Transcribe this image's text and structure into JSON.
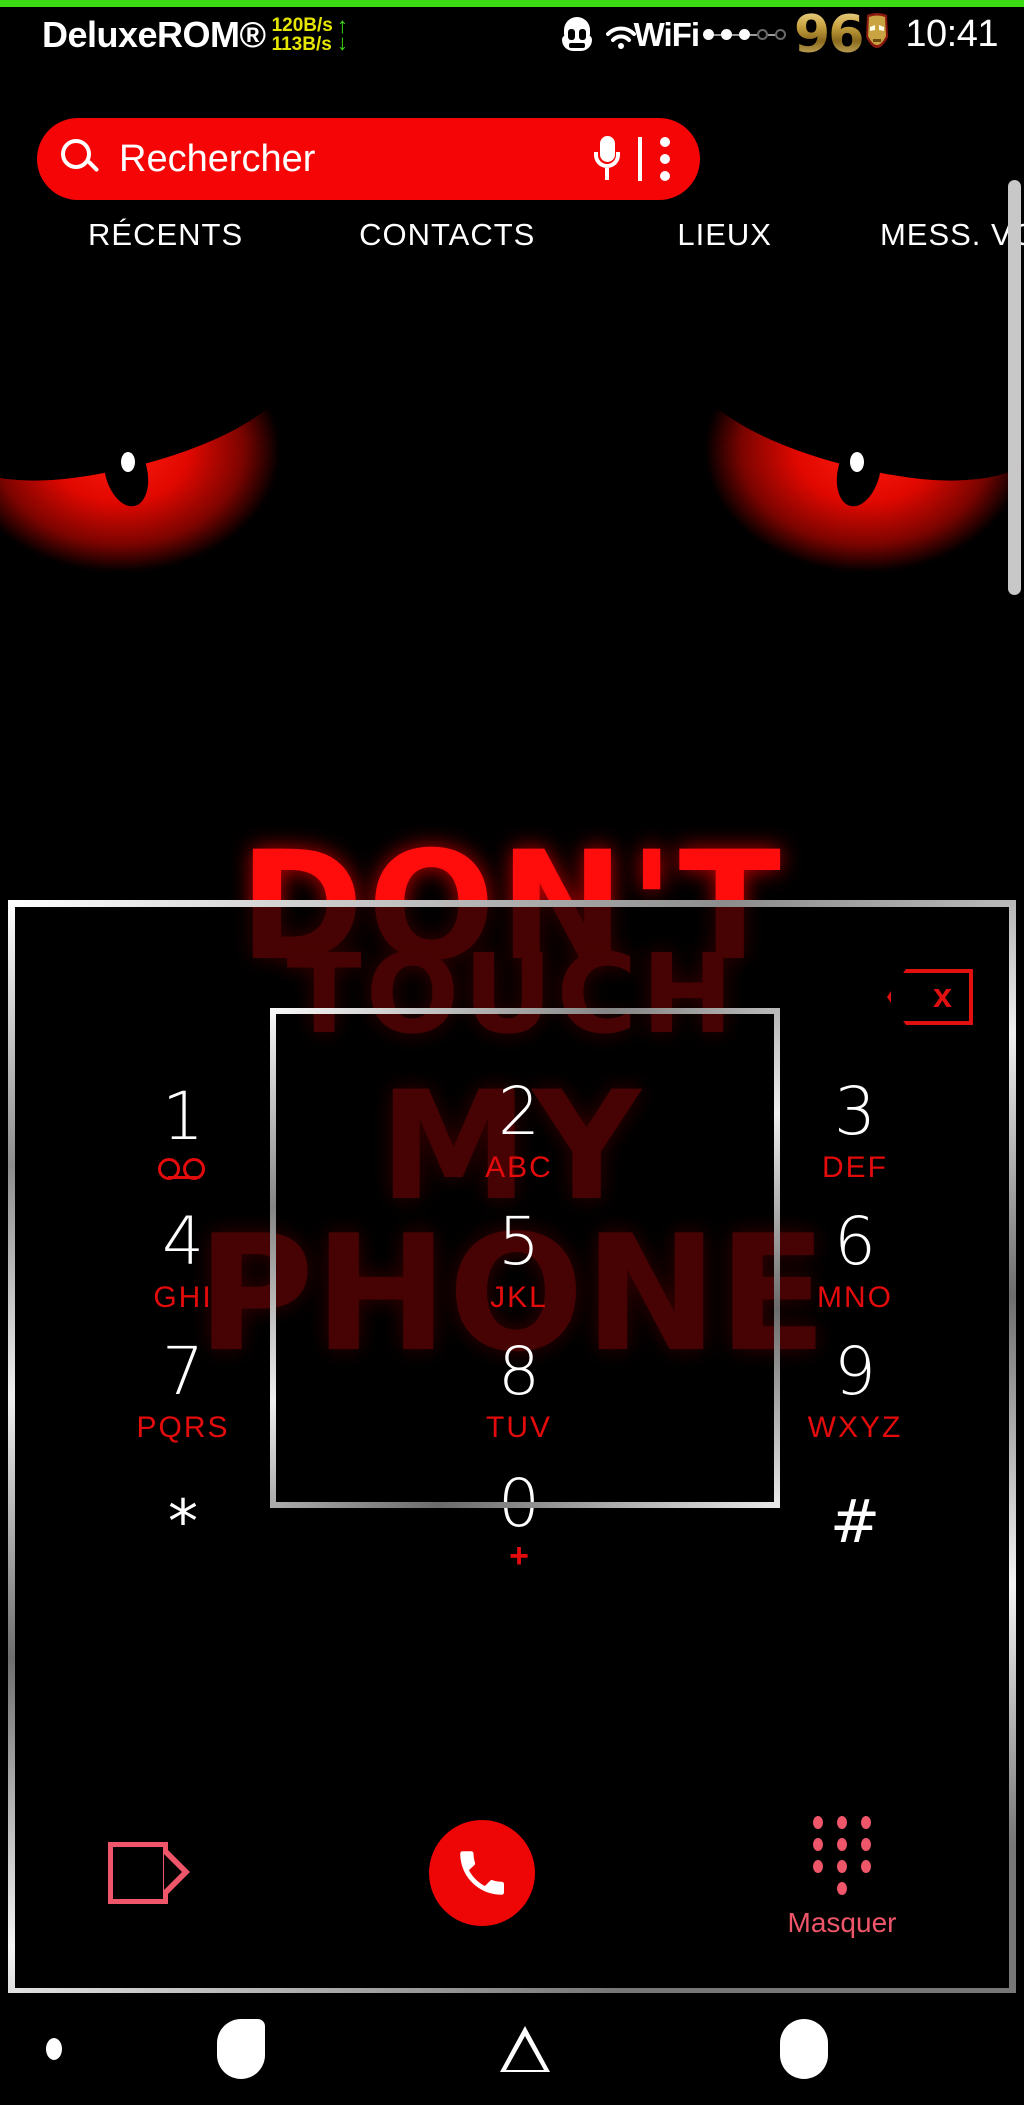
{
  "statusbar": {
    "rom_name": "DeluxeROM®",
    "net_up": "120B/s",
    "net_down": "113B/s",
    "wifi_label": "WiFi",
    "battery": "96",
    "clock": "10:41",
    "icons": {
      "stormtrooper": "stormtrooper-icon",
      "wifi": "wifi-icon",
      "signal": "signal-dots-icon",
      "ironman": "ironman-battery-icon",
      "net_arrows": "upload-download-arrows-icon"
    },
    "colors": {
      "accent_green": "#3cdc14",
      "net_speed": "#e6e600",
      "battery_gold": "#c9a341"
    }
  },
  "search": {
    "placeholder": "Rechercher",
    "value": "",
    "mic_label": "mic-icon",
    "overflow_label": "overflow-menu-icon",
    "background": "#f50505"
  },
  "tabs": [
    {
      "label": "RÉCENTS"
    },
    {
      "label": "CONTACTS"
    },
    {
      "label": "LIEUX"
    },
    {
      "label": "MESS. VOCAL"
    }
  ],
  "wallpaper": {
    "lines": [
      "DON'T",
      "TOUCH",
      "MY",
      "PHONE"
    ],
    "eye_color": "#e00800",
    "text_color": "#ff0d0d"
  },
  "dialpad": {
    "backspace_label": "backspace-icon",
    "keys": [
      {
        "digit": "1",
        "letters": "",
        "icon": "voicemail-icon"
      },
      {
        "digit": "2",
        "letters": "ABC",
        "icon": ""
      },
      {
        "digit": "3",
        "letters": "DEF",
        "icon": ""
      },
      {
        "digit": "4",
        "letters": "GHI",
        "icon": ""
      },
      {
        "digit": "5",
        "letters": "JKL",
        "icon": ""
      },
      {
        "digit": "6",
        "letters": "MNO",
        "icon": ""
      },
      {
        "digit": "7",
        "letters": "PQRS",
        "icon": ""
      },
      {
        "digit": "8",
        "letters": "TUV",
        "icon": ""
      },
      {
        "digit": "9",
        "letters": "WXYZ",
        "icon": ""
      },
      {
        "digit": "*",
        "letters": "",
        "icon": ""
      },
      {
        "digit": "0",
        "letters": "+",
        "icon": ""
      },
      {
        "digit": "#",
        "letters": "",
        "icon": ""
      }
    ]
  },
  "actions": {
    "video_call_label": "video-call-icon",
    "call_label": "call-icon",
    "hide_label": "Masquer"
  },
  "navbar": {
    "dot": "nav-dot-icon",
    "recents": "recents-icon",
    "back": "back-triangle-icon",
    "home": "home-icon"
  }
}
